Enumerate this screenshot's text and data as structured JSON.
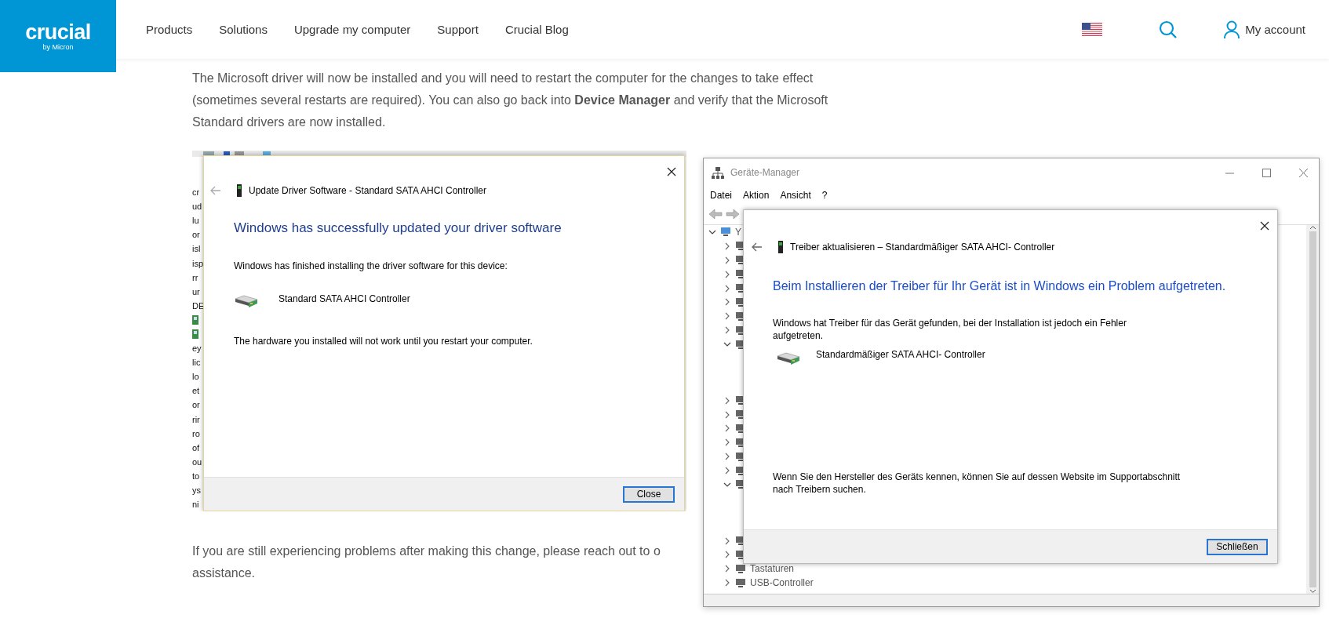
{
  "header": {
    "logo": {
      "wordmark": "crucial",
      "tagline": "by Micron"
    },
    "nav": [
      {
        "label": "Products"
      },
      {
        "label": "Solutions"
      },
      {
        "label": "Upgrade my computer"
      },
      {
        "label": "Support"
      },
      {
        "label": "Crucial Blog"
      }
    ],
    "account": "My account"
  },
  "article": {
    "intro_lines": [
      "The Microsoft driver will now be installed and you will need to restart the computer for the changes to take effect",
      "(sometimes several restarts are required). You can also go back into **Device Manager** and verify that the Microsoft",
      "Standard drivers are now installed."
    ],
    "outro_lines": [
      "If you are still experiencing problems after making this change, please reach out to o",
      "assistance."
    ]
  },
  "left_screenshot": {
    "background_fragments": [
      {
        "kind": "text",
        "text": "cr"
      },
      {
        "kind": "text",
        "text": "ud"
      },
      {
        "kind": "text",
        "text": "lu"
      },
      {
        "kind": "text",
        "text": "or"
      },
      {
        "kind": "text",
        "text": "isl"
      },
      {
        "kind": "text",
        "text": "isp"
      },
      {
        "kind": "text",
        "text": "rr"
      },
      {
        "kind": "text",
        "text": "ur"
      },
      {
        "kind": "text",
        "text": "DE"
      },
      {
        "kind": "icon"
      },
      {
        "kind": "icon"
      },
      {
        "kind": "text",
        "text": "ey"
      },
      {
        "kind": "text",
        "text": "lic"
      },
      {
        "kind": "text",
        "text": "lo"
      },
      {
        "kind": "text",
        "text": "et"
      },
      {
        "kind": "text",
        "text": "or"
      },
      {
        "kind": "text",
        "text": "rir"
      },
      {
        "kind": "text",
        "text": "ro"
      },
      {
        "kind": "text",
        "text": "of"
      },
      {
        "kind": "text",
        "text": "ou"
      },
      {
        "kind": "text",
        "text": "to"
      },
      {
        "kind": "text",
        "text": "ys"
      },
      {
        "kind": "text",
        "text": "ni"
      }
    ],
    "dialog": {
      "title": "Update Driver Software - Standard SATA AHCI Controller",
      "heading": "Windows has successfully updated your driver software",
      "message": "Windows has finished installing the driver software for this device:",
      "device": "Standard SATA AHCI Controller",
      "note": "The hardware you installed will not work until you restart your computer.",
      "button": "Close"
    }
  },
  "right_screenshot": {
    "window_title": "Geräte-Manager",
    "menu": [
      "Datei",
      "Aktion",
      "Ansicht",
      "?"
    ],
    "tree": {
      "label": "Y",
      "expanded": true,
      "children": [
        {
          "expanded": false
        },
        {
          "expanded": false
        },
        {
          "expanded": false
        },
        {
          "expanded": false
        },
        {
          "expanded": false
        },
        {
          "expanded": false
        },
        {
          "expanded": false
        },
        {
          "expanded": true
        },
        {
          "expanded": false
        },
        {
          "expanded": false
        },
        {
          "expanded": false
        },
        {
          "expanded": false
        },
        {
          "expanded": false
        },
        {
          "expanded": false
        },
        {
          "expanded": true
        },
        {
          "expanded": false
        },
        {
          "expanded": false
        },
        {
          "label": "Tastaturen",
          "expanded": false
        },
        {
          "label": "USB-Controller",
          "expanded": false
        }
      ]
    },
    "dialog": {
      "title": "Treiber aktualisieren – Standardmäßiger SATA AHCI- Controller",
      "heading": "Beim Installieren der Treiber für Ihr Gerät ist in Windows ein Problem aufgetreten.",
      "message": "Windows hat Treiber für das Gerät gefunden, bei der Installation ist jedoch ein Fehler aufgetreten.",
      "device": "Standardmäßiger SATA AHCI- Controller",
      "note": "Wenn Sie den Hersteller des Geräts kennen, können Sie auf dessen Website im Supportabschnitt nach Treibern suchen.",
      "button": "Schließen"
    }
  }
}
